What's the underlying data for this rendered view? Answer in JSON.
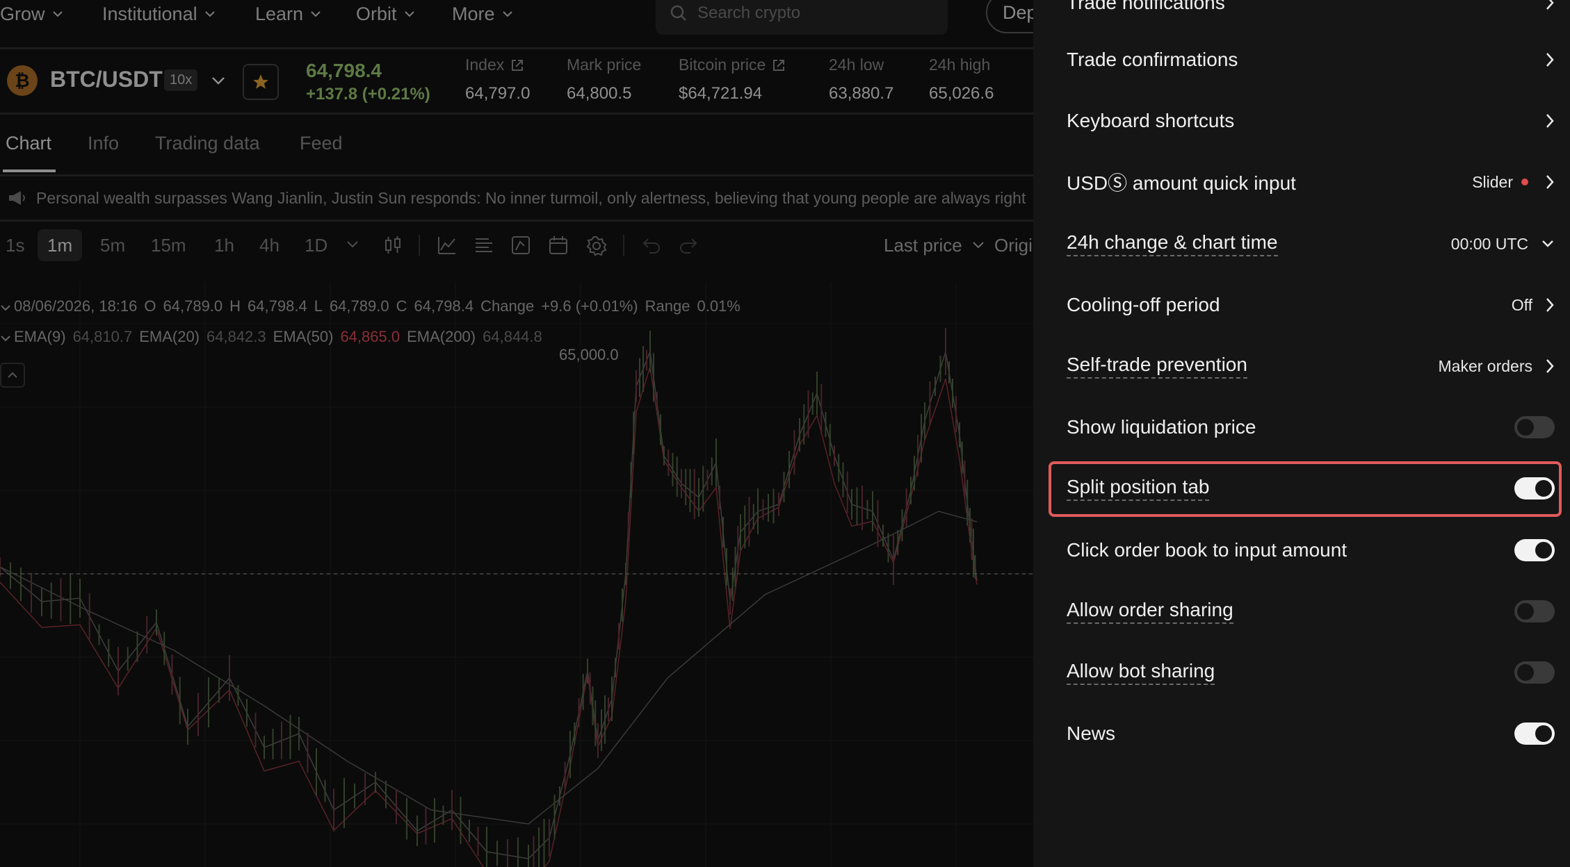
{
  "nav": {
    "items": [
      {
        "label": "Grow"
      },
      {
        "label": "Institutional"
      },
      {
        "label": "Learn"
      },
      {
        "label": "Orbit"
      },
      {
        "label": "More"
      }
    ],
    "search_placeholder": "Search crypto",
    "deposit_label": "Dep"
  },
  "ticker": {
    "coin_symbol": "₿",
    "pair": "BTC/USDT",
    "leverage": "10x",
    "last_price": "64,798.4",
    "change": "+137.8 (+0.21%)",
    "stats": [
      {
        "label": "Index",
        "value": "64,797.0"
      },
      {
        "label": "Mark price",
        "value": "64,800.5"
      },
      {
        "label": "Bitcoin price",
        "value": "$64,721.94"
      },
      {
        "label": "24h low",
        "value": "63,880.7"
      },
      {
        "label": "24h high",
        "value": "65,026.6"
      }
    ]
  },
  "tabs": [
    {
      "label": "Chart",
      "active": true
    },
    {
      "label": "Info"
    },
    {
      "label": "Trading data"
    },
    {
      "label": "Feed"
    }
  ],
  "news_ticker": "Personal wealth surpasses Wang Jianlin, Justin Sun responds: No inner turmoil, only alertness, believing that young people are always right",
  "toolbar": {
    "timeframes": [
      "1s",
      "1m",
      "5m",
      "15m",
      "1h",
      "4h",
      "1D"
    ],
    "active_timeframe": "1m",
    "price_type": "Last price",
    "view": "Original"
  },
  "ohlc": {
    "date": "08/06/2026, 18:16",
    "o_label": "O",
    "o": "64,789.0",
    "h_label": "H",
    "h": "64,798.4",
    "l_label": "L",
    "l": "64,789.0",
    "c_label": "C",
    "c": "64,798.4",
    "change_label": "Change",
    "change": "+9.6 (+0.01%)",
    "range_label": "Range",
    "range": "0.01%"
  },
  "ema": [
    {
      "label": "EMA(9)",
      "value": "64,810.7",
      "color": "#6a6a6a"
    },
    {
      "label": "EMA(20)",
      "value": "64,842.3",
      "color": "#555555"
    },
    {
      "label": "EMA(50)",
      "value": "64,865.0",
      "color": "#8a2f36"
    },
    {
      "label": "EMA(200)",
      "value": "64,844.8",
      "color": "#555555"
    }
  ],
  "chart_marker": "65,000.0",
  "settings": {
    "partial_top": "Trade notifications",
    "rows": [
      {
        "label": "Trade confirmations",
        "kind": "nav"
      },
      {
        "label": "Keyboard shortcuts",
        "kind": "nav"
      },
      {
        "label": "USDⓈ amount quick input",
        "kind": "nav",
        "value": "Slider",
        "dot": true
      },
      {
        "label": "24h change & chart time",
        "kind": "dropdown",
        "value": "00:00 UTC",
        "dashed": true
      },
      {
        "label": "Cooling-off period",
        "kind": "nav",
        "value": "Off"
      },
      {
        "label": "Self-trade prevention",
        "kind": "nav",
        "value": "Maker orders",
        "dashed": true
      },
      {
        "label": "Show liquidation price",
        "kind": "toggle",
        "on": false
      },
      {
        "label": "Split position tab",
        "kind": "toggle",
        "on": true,
        "dashed": true,
        "highlighted": true
      },
      {
        "label": "Click order book to input amount",
        "kind": "toggle",
        "on": true
      },
      {
        "label": "Allow order sharing",
        "kind": "toggle",
        "on": false,
        "dashed": true
      },
      {
        "label": "Allow bot sharing",
        "kind": "toggle",
        "on": false,
        "dashed": true
      },
      {
        "label": "News",
        "kind": "toggle",
        "on": true
      }
    ]
  },
  "colors": {
    "up": "#5e7a45",
    "down": "#8a2f36",
    "highlight": "#e05a5a",
    "panel_bg": "#151515"
  }
}
